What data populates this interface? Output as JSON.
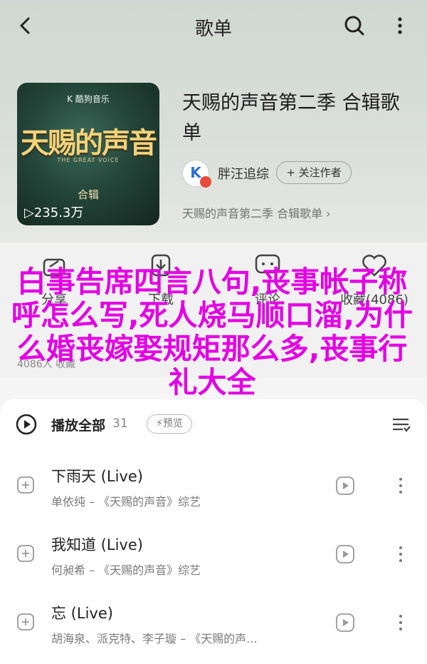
{
  "topbar": {
    "title": "歌单"
  },
  "playlist": {
    "title": "天赐的声音第二季  合辑歌单",
    "creator": "胖汪追综",
    "follow_label": "+ 关注作者",
    "description": "天赐的声音第二季 合辑歌单 ›",
    "cover": {
      "brand": "K 酷狗音乐",
      "title": "天赐的声音",
      "subtitle": "THE GREAT VOICE",
      "badge": "合辑",
      "play_count": "▷235.3万"
    }
  },
  "actions": [
    {
      "label": "分享",
      "icon": "share-icon"
    },
    {
      "label": "下载",
      "icon": "download-icon"
    },
    {
      "label": "评论",
      "icon": "comment-icon"
    },
    {
      "label": "收藏(4086)",
      "icon": "favorite-icon"
    }
  ],
  "users_text": "4086人 收藏",
  "overlay_text": "白事告席四言八句,丧事帐子称呼怎么写,死人烧马顺口溜,为什么婚丧嫁娶规矩那么多,丧事行礼大全",
  "list_header": {
    "play_all": "播放全部",
    "count": "31",
    "preview": "预览"
  },
  "songs": [
    {
      "title": "下雨天 (Live)",
      "info": "单依纯 – 《天赐的声音》综艺"
    },
    {
      "title": "我知道 (Live)",
      "info": "何昶希 – 《天赐的声音》综艺"
    },
    {
      "title": "忘 (Live)",
      "info": "胡海泉、派克特、李子璇 – 《天赐的声..."
    }
  ],
  "colors": {
    "overlay": "#e400e4",
    "accent": "#2c6fd8"
  }
}
